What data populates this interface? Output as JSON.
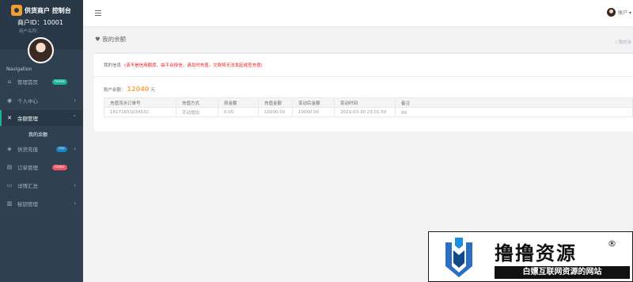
{
  "brand": {
    "title": "供货商户 控制台"
  },
  "merchant": {
    "id_label": "商户ID：10001",
    "name_label": "商户名称："
  },
  "nav": {
    "heading": "Navigation",
    "items": [
      {
        "label": "管理首页",
        "icon": "home-icon",
        "badge": "home"
      },
      {
        "label": "个人中心",
        "icon": "user-icon"
      },
      {
        "label": "余额管理",
        "icon": "tools-icon",
        "active": true
      },
      {
        "label": "供货充值",
        "icon": "cube-icon",
        "badge": "PAY"
      },
      {
        "label": "订单管理",
        "icon": "list-icon",
        "badge": "Order"
      },
      {
        "label": "详情汇总",
        "icon": "doc-icon"
      },
      {
        "label": "秘钥管理",
        "icon": "map-icon"
      }
    ],
    "sub_item": "我的余额"
  },
  "topbar": {
    "user_label": "账户 ▾"
  },
  "page": {
    "title": "♥ 我的余额",
    "breadcrumb": "/ 我的余"
  },
  "box": {
    "title": "我的信息",
    "warning": "(该不是信用额度，由平台授信，请及时充值，欠费将无法发起或查充值)",
    "balance_label": "账户余额：",
    "balance_value": "12040",
    "balance_unit": "元"
  },
  "table": {
    "headers": [
      "充值流水订单号",
      "充值方式",
      "原金额",
      "充值金额",
      "变动后金额",
      "变动时间",
      "备注"
    ],
    "rows": [
      [
        "16171651034532",
        "手动增加",
        "0.00",
        "10000.00",
        "10000.00",
        "2021-03-30 23:01:50",
        "gg"
      ]
    ]
  },
  "watermark": {
    "title": "撸撸资源",
    "reg": "®",
    "subtitle": "白嫖互联网资源的网站"
  },
  "colors": {
    "sidebar": "#2f4050",
    "accent": "#1ab394",
    "balance": "#f8ac59",
    "warning": "#ed1c24"
  }
}
